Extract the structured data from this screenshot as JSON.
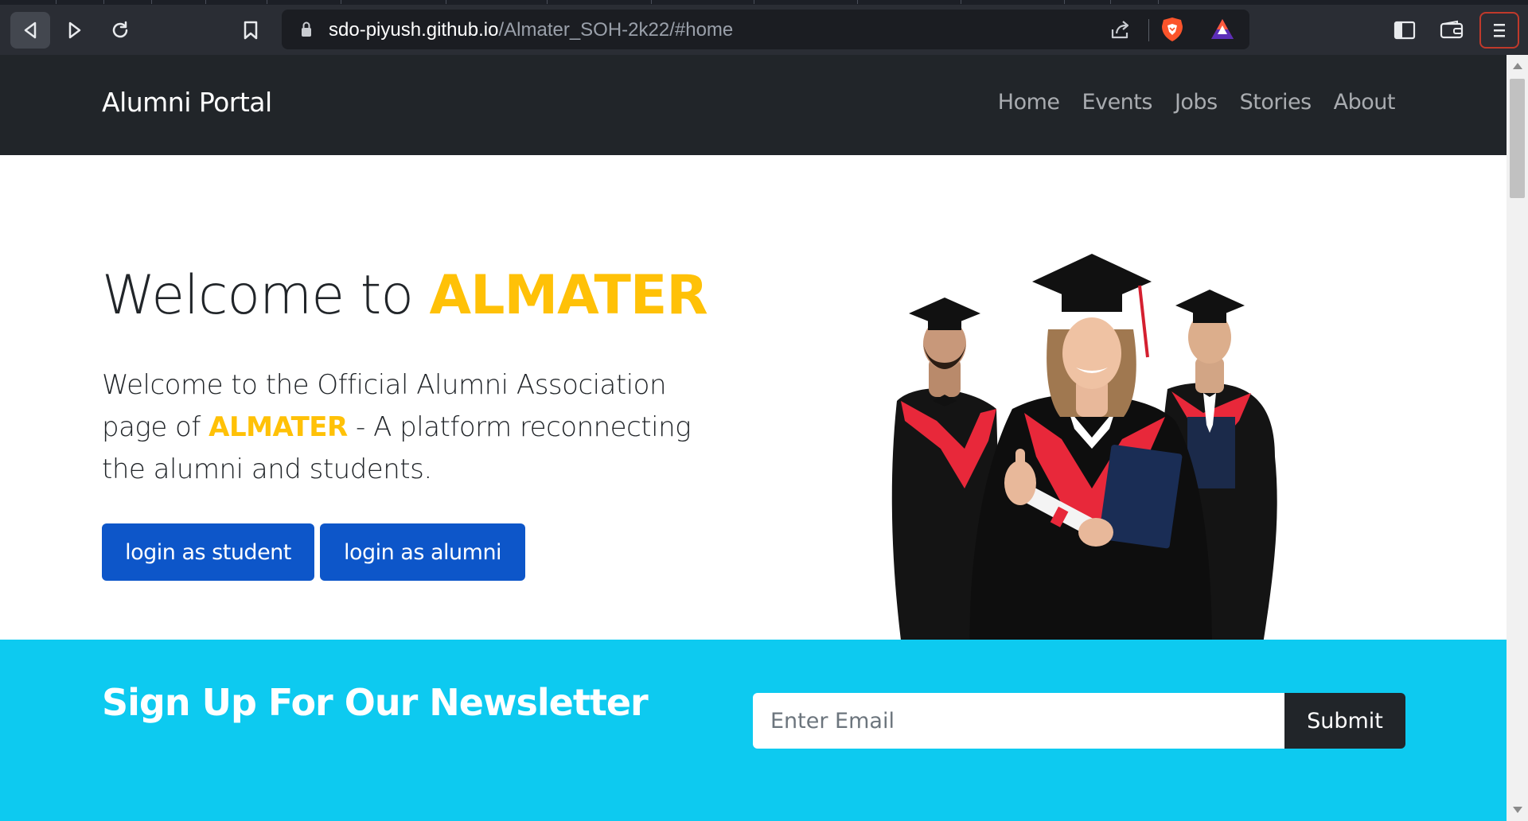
{
  "browser": {
    "url_host": "sdo-piyush.github.io",
    "url_path": "/Almater_SOH-2k22/#home"
  },
  "navbar": {
    "brand": "Alumni Portal",
    "links": [
      "Home",
      "Events",
      "Jobs",
      "Stories",
      "About"
    ]
  },
  "hero": {
    "title_prefix": "Welcome to ",
    "title_accent": "ALMATER",
    "text_before": "Welcome to the Official Alumni Association page of ",
    "text_accent": "ALMATER",
    "text_after": " - A platform reconnecting the alumni and students.",
    "student_button": "login as student",
    "alumni_button": "login as alumni"
  },
  "newsletter": {
    "title": "Sign Up For Our Newsletter",
    "placeholder": "Enter Email",
    "submit": "Submit"
  },
  "colors": {
    "navbar_bg": "#212529",
    "accent": "#ffc107",
    "primary": "#0d56c9",
    "newsletter_bg": "#0dcaf0",
    "gown_red": "#e8283a"
  }
}
